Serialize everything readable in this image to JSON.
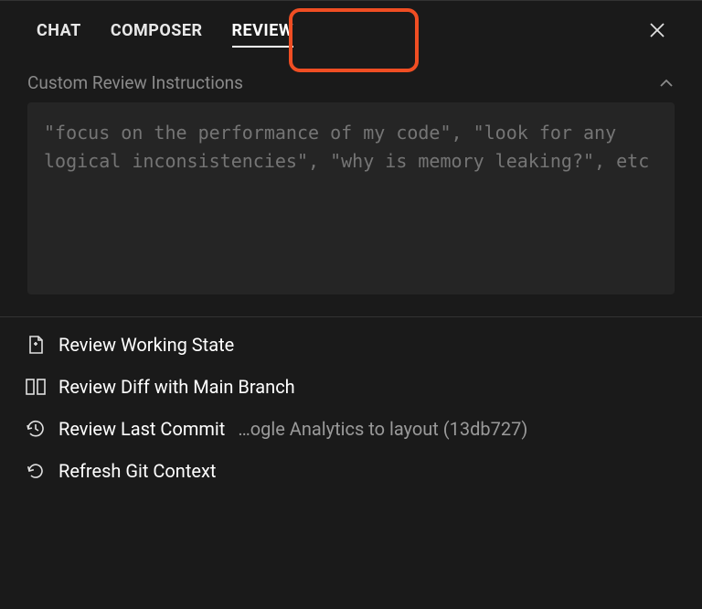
{
  "tabs": {
    "chat": "CHAT",
    "composer": "COMPOSER",
    "review": "REVIEW"
  },
  "section": {
    "title": "Custom Review Instructions",
    "placeholder": "\"focus on the performance of my code\", \"look for any logical inconsistencies\", \"why is memory leaking?\", etc"
  },
  "actions": {
    "working_state": "Review Working State",
    "diff_main": "Review Diff with Main Branch",
    "last_commit": "Review Last Commit",
    "last_commit_detail": "…ogle Analytics to layout (13db727)",
    "refresh": "Refresh Git Context"
  }
}
